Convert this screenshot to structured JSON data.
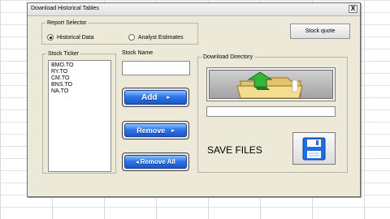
{
  "window": {
    "title": "Download Historical Tables",
    "close_label": "X"
  },
  "report_selector": {
    "legend": "Report Selector",
    "options": [
      {
        "label": "Historical Data",
        "selected": true
      },
      {
        "label": "Analyst Estimates",
        "selected": false
      }
    ]
  },
  "stock_quote_button": "Stock quote",
  "stock_ticker": {
    "legend": "Stock Ticker",
    "items": [
      "BMO.TO",
      "RY.TO",
      "CM.TO",
      "BNS.TO",
      "NA.TO"
    ]
  },
  "stock_name": {
    "label": "Stock Name",
    "value": ""
  },
  "buttons": {
    "add": "Add",
    "add_arrow": "▸",
    "remove": "Remove",
    "remove_arrow": "▸",
    "remove_all": "Remove All",
    "remove_all_arrow": "◂"
  },
  "download_directory": {
    "legend": "Download Directory",
    "path_value": "",
    "icon": "folder-download-icon"
  },
  "save": {
    "label": "SAVE FILES",
    "icon": "floppy-disk-icon"
  },
  "colors": {
    "button_blue": "#2f77e8",
    "dialog_bg": "#ece9d8",
    "disk_blue": "#1f6fe0"
  }
}
